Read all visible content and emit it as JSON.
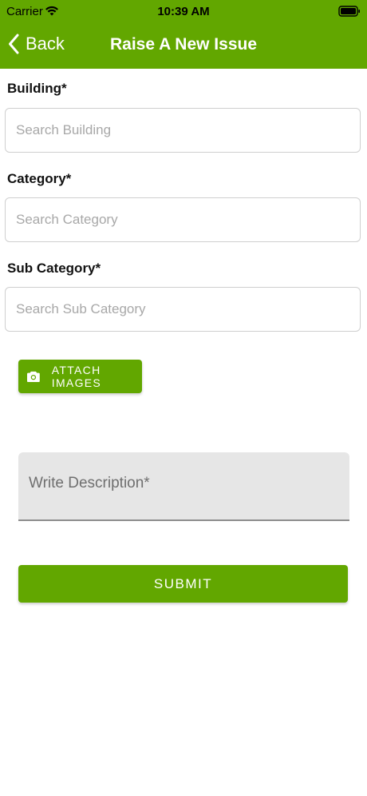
{
  "status_bar": {
    "carrier": "Carrier",
    "time": "10:39 AM"
  },
  "nav": {
    "back_label": "Back",
    "title": "Raise A New Issue"
  },
  "form": {
    "building": {
      "label": "Building*",
      "placeholder": "Search Building",
      "value": ""
    },
    "category": {
      "label": "Category*",
      "placeholder": "Search Category",
      "value": ""
    },
    "sub_category": {
      "label": "Sub Category*",
      "placeholder": "Search Sub Category",
      "value": ""
    },
    "attach_label": "ATTACH IMAGES",
    "description": {
      "placeholder": "Write Description*",
      "value": ""
    },
    "submit_label": "SUBMIT"
  },
  "colors": {
    "brand": "#62a700",
    "field_border": "#cfcfcf",
    "description_bg": "#e6e6e6"
  },
  "icons": {
    "back": "chevron-left-icon",
    "attach": "camera-icon",
    "wifi": "wifi-icon",
    "battery": "battery-icon"
  }
}
